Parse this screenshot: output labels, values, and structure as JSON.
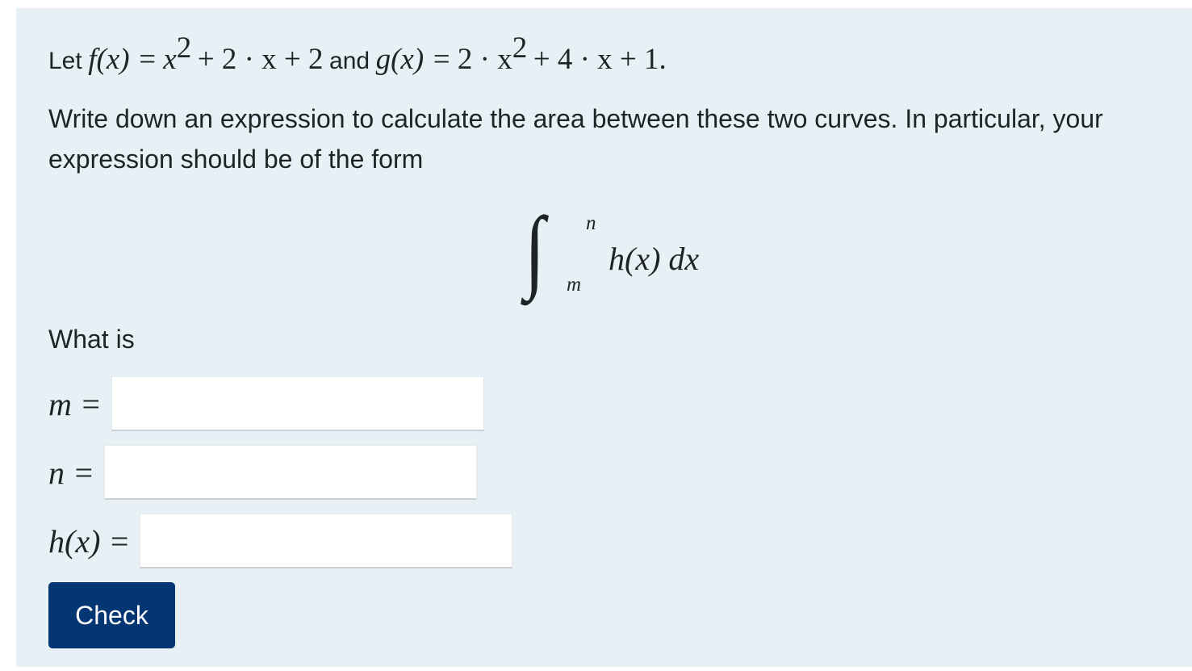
{
  "question": {
    "intro": {
      "let_word": "Let",
      "f_lhs": "f(x) =",
      "f_rhs_a": "x",
      "f_rhs_a_exp": "2",
      "f_rhs_b": "+ 2 · x + 2",
      "and_word": "and",
      "g_lhs": "g(x) =",
      "g_rhs_a": "2 · x",
      "g_rhs_a_exp": "2",
      "g_rhs_b": "+ 4 · x + 1."
    },
    "instruction": "Write down an expression to calculate the area between these two curves. In particular, your expression should be of the form",
    "integral": {
      "sign": "∫",
      "upper_limit": "n",
      "lower_limit": "m",
      "integrand": "h(x) dx"
    },
    "prompt": "What is"
  },
  "answers": {
    "m": {
      "label": "m =",
      "value": "",
      "placeholder": ""
    },
    "n": {
      "label": "n =",
      "value": "",
      "placeholder": ""
    },
    "h": {
      "label": "h(x) =",
      "value": "",
      "placeholder": ""
    }
  },
  "check_button": {
    "label": "Check",
    "color": "#043673"
  },
  "colors": {
    "panel_background": "#e7f1f5",
    "text": "#1d2327"
  }
}
